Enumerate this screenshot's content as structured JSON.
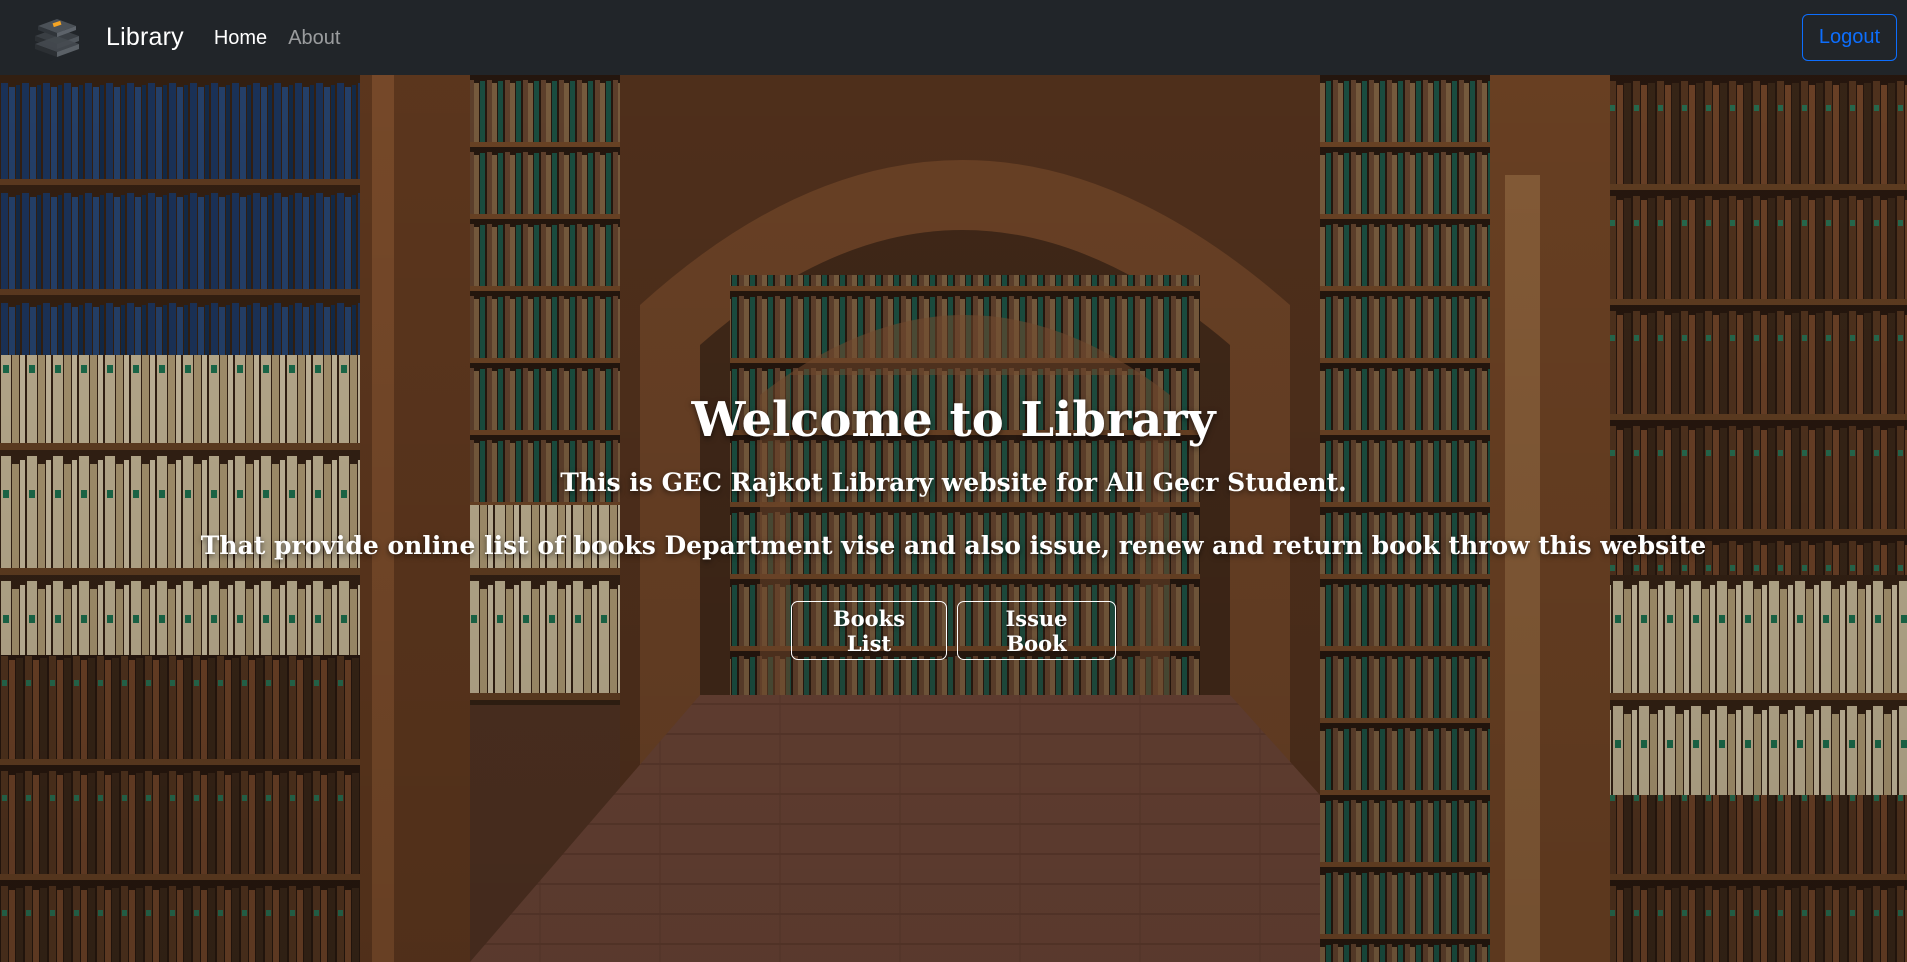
{
  "navbar": {
    "brand": "Library",
    "logo_icon": "books-stack-icon",
    "links": [
      {
        "label": "Home",
        "active": true
      },
      {
        "label": "About",
        "active": false
      }
    ],
    "logout_label": "Logout",
    "accent_color": "#0d6efd",
    "background_color": "#212529"
  },
  "hero": {
    "background_image": "library-bookshelves-arch",
    "title": "Welcome to Library",
    "subtitle": "This is GEC Rajkot Library website for All Gecr Student.",
    "description": "That provide online list of books Department vise and also issue, renew and return book throw this website",
    "buttons": [
      {
        "label": "Books List"
      },
      {
        "label": "Issue Book"
      }
    ]
  }
}
